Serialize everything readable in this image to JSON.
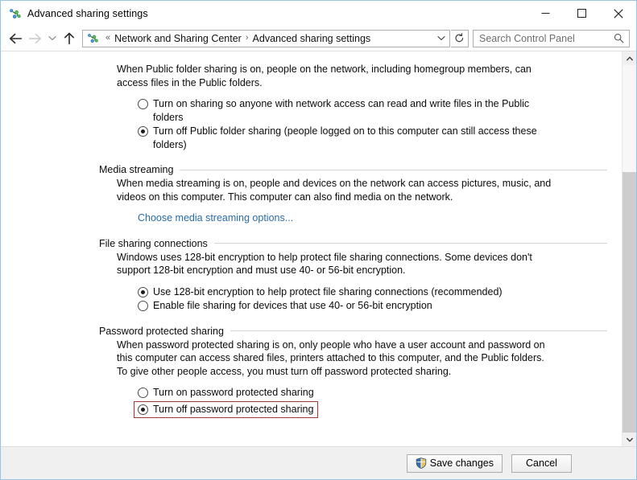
{
  "window": {
    "title": "Advanced sharing settings",
    "icon": "network-sharing-icon",
    "border_color": "#9bc4e2",
    "controls": {
      "minimize": "minimize-button",
      "maximize": "maximize-button",
      "close": "close-button"
    }
  },
  "navbar": {
    "back": "back-arrow",
    "forward": "forward-arrow",
    "recent": "recent-locations-chevron",
    "up": "up-arrow",
    "breadcrumb": {
      "icon": "network-sharing-icon",
      "overflow": "«",
      "items": [
        {
          "label": "Network and Sharing Center",
          "separator": "›"
        },
        {
          "label": "Advanced sharing settings",
          "separator": ""
        }
      ],
      "dropdown": "address-dropdown-chevron"
    },
    "refresh": "refresh-icon",
    "search": {
      "placeholder": "Search Control Panel",
      "value": "",
      "icon": "search-icon"
    }
  },
  "content": {
    "public_folder": {
      "description": "When Public folder sharing is on, people on the network, including homegroup members, can access files in the Public folders.",
      "options": [
        {
          "label": "Turn on sharing so anyone with network access can read and write files in the Public folders",
          "checked": false,
          "highlighted": false
        },
        {
          "label": "Turn off Public folder sharing (people logged on to this computer can still access these folders)",
          "checked": true,
          "highlighted": false
        }
      ]
    },
    "sections": [
      {
        "title": "Media streaming",
        "description": "When media streaming is on, people and devices on the network can access pictures, music, and videos on this computer. This computer can also find media on the network.",
        "link": "Choose media streaming options...",
        "link_color": "#2a6ba8",
        "options": []
      },
      {
        "title": "File sharing connections",
        "description": "Windows uses 128-bit encryption to help protect file sharing connections. Some devices don't support 128-bit encryption and must use 40- or 56-bit encryption.",
        "link": "",
        "options": [
          {
            "label": "Use 128-bit encryption to help protect file sharing connections (recommended)",
            "checked": true,
            "highlighted": false
          },
          {
            "label": "Enable file sharing for devices that use 40- or 56-bit encryption",
            "checked": false,
            "highlighted": false
          }
        ]
      },
      {
        "title": "Password protected sharing",
        "description": "When password protected sharing is on, only people who have a user account and password on this computer can access shared files, printers attached to this computer, and the Public folders. To give other people access, you must turn off password protected sharing.",
        "link": "",
        "options": [
          {
            "label": "Turn on password protected sharing",
            "checked": false,
            "highlighted": false
          },
          {
            "label": "Turn off password protected sharing",
            "checked": true,
            "highlighted": true,
            "highlight_color": "#9c3b33"
          }
        ]
      }
    ]
  },
  "scrollbar": {
    "up_arrow": "scroll-up-arrow",
    "down_arrow": "scroll-down-arrow",
    "thumb_position": "top"
  },
  "footer": {
    "save_label": "Save changes",
    "save_icon": "uac-shield-icon",
    "cancel_label": "Cancel"
  }
}
